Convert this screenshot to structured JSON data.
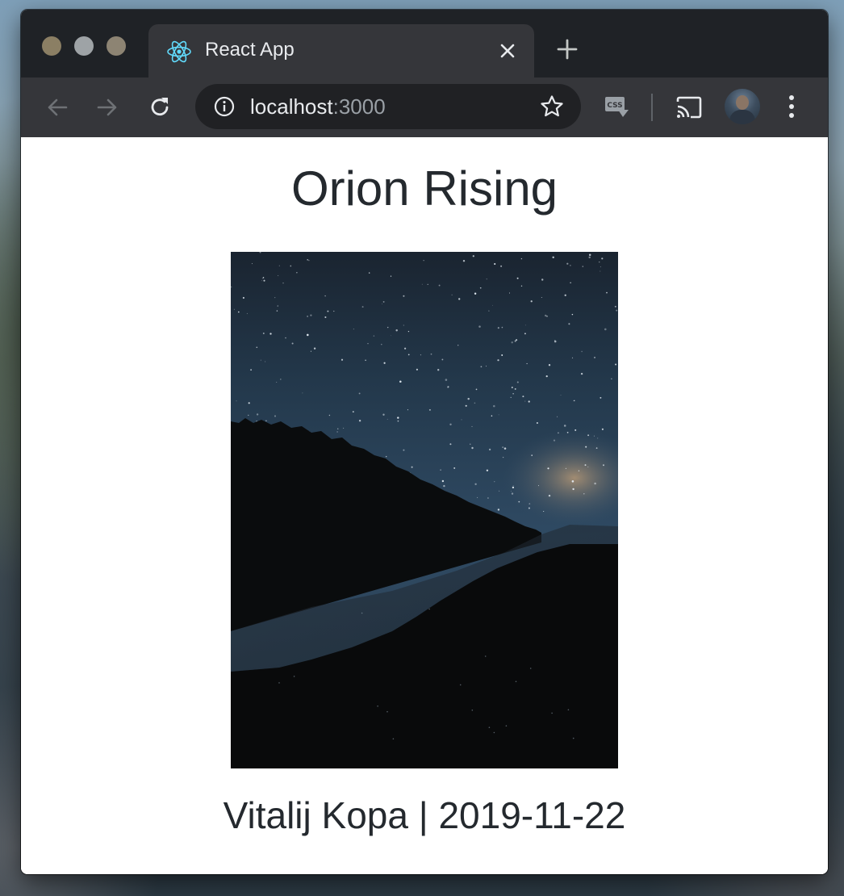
{
  "browser": {
    "tab": {
      "title": "React App",
      "favicon": "react-logo-icon"
    },
    "address_bar": {
      "host": "localhost",
      "port": ":3000"
    },
    "toolbar_icons": [
      "back-arrow-icon",
      "forward-arrow-icon",
      "reload-icon",
      "info-icon",
      "bookmark-star-icon",
      "css-extension-icon",
      "cast-icon",
      "profile-avatar",
      "more-menu-icon"
    ],
    "colors": {
      "frame": "#1f2226",
      "toolbar": "#35363a",
      "omnibox": "#202124"
    }
  },
  "page": {
    "title": "Orion Rising",
    "image_alt": "Orion Rising",
    "caption": "Vitalij Kopa | 2019-11-22",
    "text_color": "#24292e"
  }
}
